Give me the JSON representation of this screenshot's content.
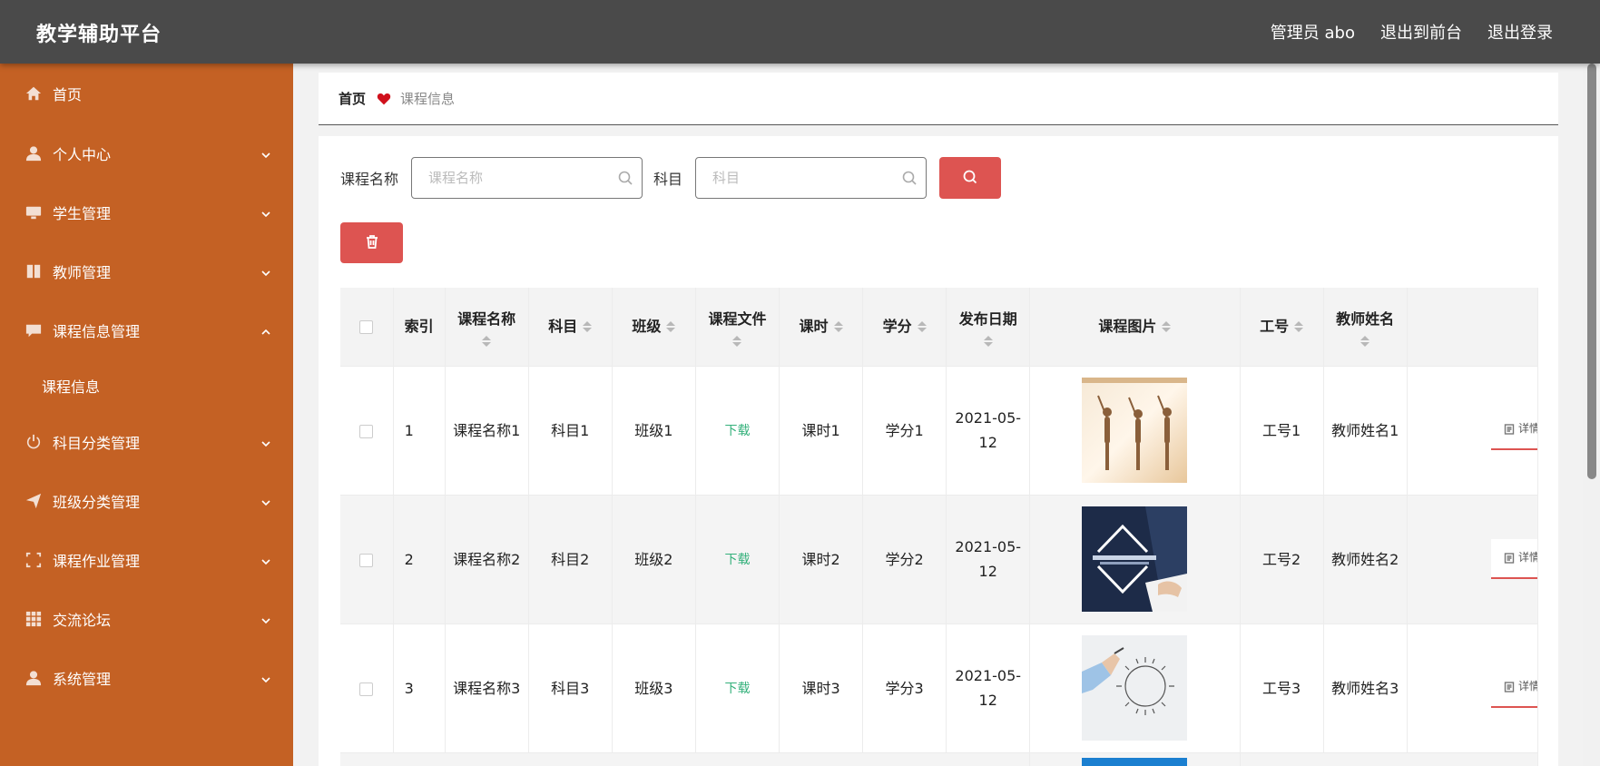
{
  "header": {
    "title": "教学辅助平台",
    "nav": [
      "管理员 abo",
      "退出到前台",
      "退出登录"
    ]
  },
  "sidebar": {
    "items": [
      {
        "label": "首页",
        "icon": "home-icon",
        "expandable": false
      },
      {
        "label": "个人中心",
        "icon": "user-icon",
        "expandable": true
      },
      {
        "label": "学生管理",
        "icon": "monitor-icon",
        "expandable": true
      },
      {
        "label": "教师管理",
        "icon": "book-icon",
        "expandable": true
      },
      {
        "label": "课程信息管理",
        "icon": "chat-icon",
        "expandable": true,
        "expanded": true,
        "children": [
          "课程信息"
        ]
      },
      {
        "label": "科目分类管理",
        "icon": "power-icon",
        "expandable": true
      },
      {
        "label": "班级分类管理",
        "icon": "send-icon",
        "expandable": true
      },
      {
        "label": "课程作业管理",
        "icon": "frame-icon",
        "expandable": true
      },
      {
        "label": "交流论坛",
        "icon": "grid-icon",
        "expandable": true
      },
      {
        "label": "系统管理",
        "icon": "user-icon",
        "expandable": true
      }
    ]
  },
  "breadcrumb": {
    "home": "首页",
    "current": "课程信息"
  },
  "search": {
    "course_label": "课程名称",
    "course_placeholder": "课程名称",
    "subject_label": "科目",
    "subject_placeholder": "科目"
  },
  "table": {
    "headers": [
      "索引",
      "课程名称",
      "科目",
      "班级",
      "课程文件",
      "课时",
      "学分",
      "发布日期",
      "课程图片",
      "工号",
      "教师姓名"
    ],
    "download_label": "下载",
    "detail_label": "详情",
    "rows": [
      {
        "index": "1",
        "name": "课程名称1",
        "subject": "科目1",
        "class": "班级1",
        "hours": "课时1",
        "credit": "学分1",
        "date": "2021-05-12",
        "image": "yoga-photo",
        "job_no": "工号1",
        "teacher": "教师姓名1"
      },
      {
        "index": "2",
        "name": "课程名称2",
        "subject": "科目2",
        "class": "班级2",
        "hours": "课时2",
        "credit": "学分2",
        "date": "2021-05-12",
        "image": "english-course-photo",
        "job_no": "工号2",
        "teacher": "教师姓名2"
      },
      {
        "index": "3",
        "name": "课程名称3",
        "subject": "科目3",
        "class": "班级3",
        "hours": "课时3",
        "credit": "学分3",
        "date": "2021-05-12",
        "image": "business-training-photo",
        "job_no": "工号3",
        "teacher": "教师姓名3"
      }
    ]
  },
  "colors": {
    "header": "#4a4a4a",
    "sidebar": "#c46124",
    "accent": "#dd5451",
    "download": "#33b07a"
  }
}
